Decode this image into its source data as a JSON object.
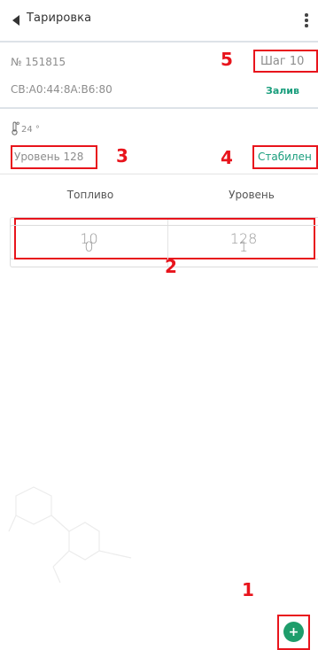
{
  "appbar": {
    "title": "Тарировка"
  },
  "device": {
    "number": "№ 151815",
    "step": "Шаг 10",
    "mac": "CB:A0:44:8A:B6:80",
    "mode": "Залив"
  },
  "sensor": {
    "temperature": "24 °",
    "level": "Уровень 128",
    "status": "Стабилен"
  },
  "table": {
    "headers": {
      "fuel": "Топливо",
      "level": "Уровень"
    },
    "rows": [
      {
        "fuel": "10",
        "level": "128"
      },
      {
        "fuel": "0",
        "level": "1"
      }
    ]
  },
  "annotations": {
    "a1": "1",
    "a2": "2",
    "a3": "3",
    "a4": "4",
    "a5": "5"
  },
  "fab": {
    "label": "+"
  },
  "colors": {
    "accent": "#1a9e7d",
    "fab": "#1e9d6b",
    "highlight": "#e8141c"
  }
}
